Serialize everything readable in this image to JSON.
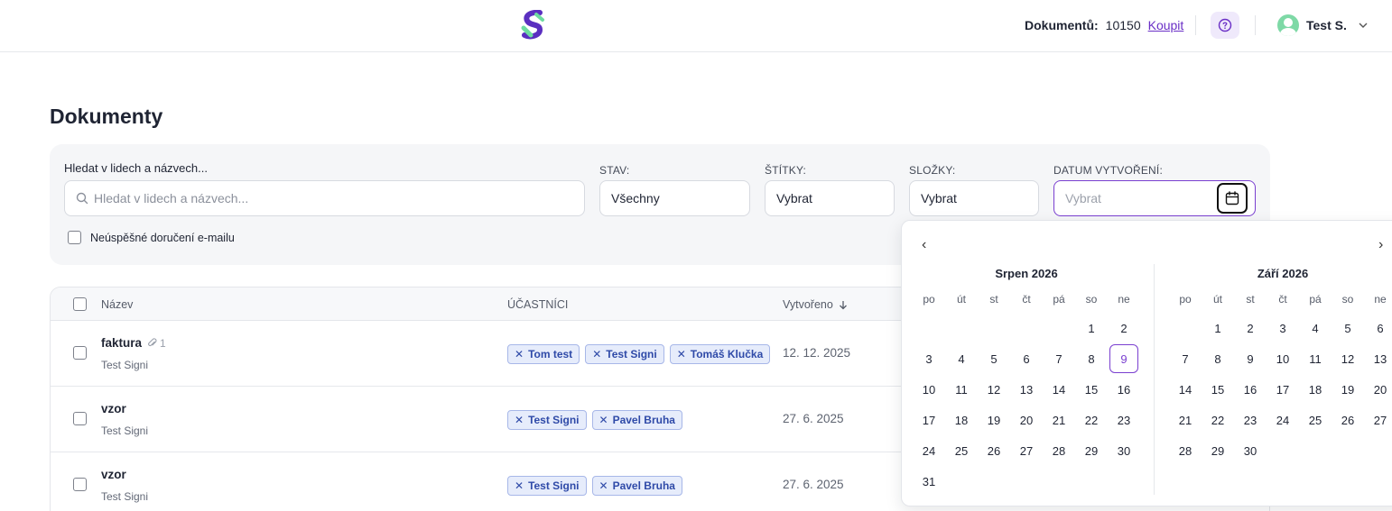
{
  "header": {
    "doc_label": "Dokumentů:",
    "doc_count": "10150",
    "buy_label": "Koupit",
    "user_name": "Test S."
  },
  "page": {
    "title": "Dokumenty"
  },
  "filters": {
    "search_label": "Hledat v lidech a názvech...",
    "search_placeholder": "Hledat v lidech a názvech...",
    "status_label": "STAV:",
    "status_value": "Všechny",
    "tags_label": "ŠTÍTKY:",
    "tags_value": "Vybrat",
    "folders_label": "SLOŽKY:",
    "folders_value": "Vybrat",
    "date_label": "DATUM VYTVOŘENÍ:",
    "date_placeholder": "Vybrat",
    "failed_email_label": "Neúspěšné doručení e-mailu"
  },
  "table": {
    "col_name": "Název",
    "col_participants": "ÚČASTNÍCI",
    "col_created": "Vytvořeno",
    "rows": [
      {
        "name": "faktura",
        "attachments": "1",
        "owner": "Test Signi",
        "participants": [
          "Tom test",
          "Test Signi",
          "Tomáš Klučka"
        ],
        "created": "12. 12. 2025"
      },
      {
        "name": "vzor",
        "attachments": "",
        "owner": "Test Signi",
        "participants": [
          "Test Signi",
          "Pavel Bruha"
        ],
        "created": "27. 6. 2025"
      },
      {
        "name": "vzor",
        "attachments": "",
        "owner": "Test Signi",
        "participants": [
          "Test Signi",
          "Pavel Bruha"
        ],
        "created": "27. 6. 2025"
      }
    ]
  },
  "datepicker": {
    "prev": "‹",
    "next": "›",
    "weekdays": [
      "po",
      "út",
      "st",
      "čt",
      "pá",
      "so",
      "ne"
    ],
    "months": [
      {
        "title": "Srpen 2026",
        "offset": 5,
        "days": 31,
        "selected": 9
      },
      {
        "title": "Září 2026",
        "offset": 1,
        "days": 30,
        "selected": null
      }
    ]
  },
  "colors": {
    "accent": "#7a3fd0",
    "chip_bg": "#e6ecfb",
    "chip_text": "#2f4aa8"
  }
}
